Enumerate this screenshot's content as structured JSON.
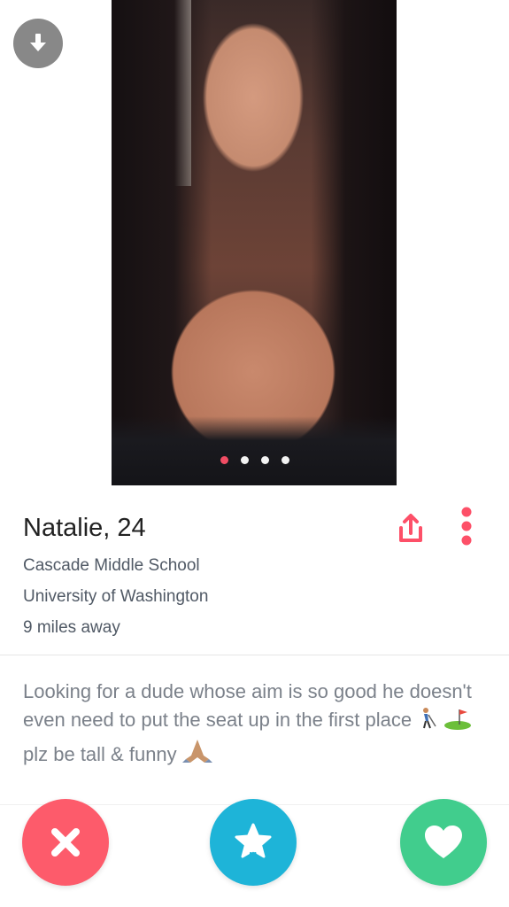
{
  "profile": {
    "name_age": "Natalie, 24",
    "school_1": "Cascade Middle School",
    "school_2": "University of Washington",
    "distance": "9 miles away",
    "bio_text_1": "Looking for a dude whose aim is so good he doesn't even need to put the seat up in the first place",
    "bio_text_2": "plz be tall & funny"
  },
  "photo": {
    "count": 4,
    "active_index": 0
  },
  "icons": {
    "download": "download-icon",
    "share": "share-icon",
    "more": "more-vertical-icon",
    "nope": "close-icon",
    "super_like": "star-icon",
    "like": "heart-icon",
    "emoji_1": "golfer-emoji",
    "emoji_2": "flag-in-hole-emoji",
    "emoji_3": "folded-hands-emoji"
  },
  "colors": {
    "accent": "#fd5068",
    "nope": "#fd5b6b",
    "super_like": "#1eb4d8",
    "like": "#41cd8d"
  }
}
